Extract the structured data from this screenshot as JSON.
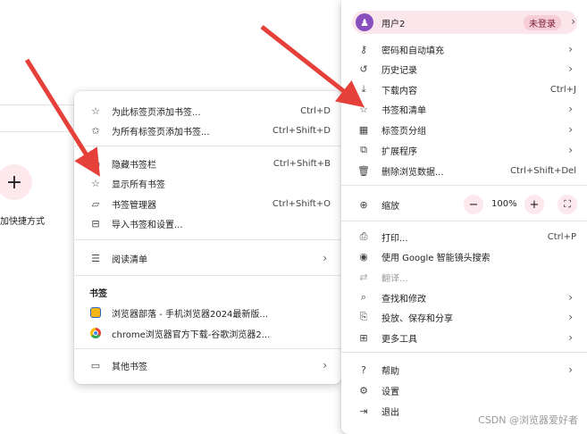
{
  "background": {
    "add_button_icon": "+",
    "add_shortcut_label": "加快捷方式"
  },
  "bookmarks_menu": {
    "items": [
      {
        "label": "为此标签页添加书签...",
        "shortcut": "Ctrl+D",
        "icon": "star-outline-icon"
      },
      {
        "label": "为所有标签页添加书签...",
        "shortcut": "Ctrl+Shift+D",
        "icon": "star-multi-icon"
      },
      {
        "label": "隐藏书签栏",
        "shortcut": "Ctrl+Shift+B",
        "icon": "bookmark-bar-icon"
      },
      {
        "label": "显示所有书签",
        "shortcut": "",
        "icon": "star-outline-icon"
      },
      {
        "label": "书签管理器",
        "shortcut": "Ctrl+Shift+O",
        "icon": "folder-star-icon"
      },
      {
        "label": "导入书签和设置...",
        "shortcut": "",
        "icon": "import-icon"
      }
    ],
    "reading_list": {
      "label": "阅读清单",
      "icon": "list-icon"
    },
    "section_title": "书签",
    "bookmarks": [
      {
        "label": "浏览器部落 - 手机浏览器2024最新版..."
      },
      {
        "label": "chrome浏览器官方下载-谷歌浏览器2..."
      }
    ],
    "other_bookmarks": {
      "label": "其他书签",
      "icon": "folder-icon"
    }
  },
  "main_menu": {
    "profile": {
      "name": "用户2",
      "status": "未登录"
    },
    "group1": [
      {
        "label": "密码和自动填充",
        "shortcut": "",
        "arrow": true,
        "icon": "key-icon"
      },
      {
        "label": "历史记录",
        "shortcut": "",
        "arrow": true,
        "icon": "history-icon"
      },
      {
        "label": "下载内容",
        "shortcut": "Ctrl+J",
        "arrow": false,
        "icon": "download-icon"
      },
      {
        "label": "书签和清单",
        "shortcut": "",
        "arrow": true,
        "icon": "star-icon"
      },
      {
        "label": "标签页分组",
        "shortcut": "",
        "arrow": true,
        "icon": "grid-icon"
      },
      {
        "label": "扩展程序",
        "shortcut": "",
        "arrow": true,
        "icon": "puzzle-icon"
      },
      {
        "label": "删除浏览数据...",
        "shortcut": "Ctrl+Shift+Del",
        "arrow": false,
        "icon": "trash-icon"
      }
    ],
    "zoom": {
      "label": "缩放",
      "minus": "−",
      "value": "100%",
      "plus": "+"
    },
    "group2": [
      {
        "label": "打印...",
        "shortcut": "Ctrl+P",
        "arrow": false,
        "icon": "print-icon"
      },
      {
        "label": "使用 Google 智能镜头搜索",
        "shortcut": "",
        "arrow": false,
        "icon": "lens-icon"
      },
      {
        "label": "翻译...",
        "shortcut": "",
        "arrow": false,
        "icon": "translate-icon"
      },
      {
        "label": "查找和修改",
        "shortcut": "",
        "arrow": true,
        "icon": "find-icon"
      },
      {
        "label": "投放、保存和分享",
        "shortcut": "",
        "arrow": true,
        "icon": "cast-icon"
      },
      {
        "label": "更多工具",
        "shortcut": "",
        "arrow": true,
        "icon": "toolbox-icon"
      }
    ],
    "group3": [
      {
        "label": "帮助",
        "shortcut": "",
        "arrow": true,
        "icon": "help-icon"
      },
      {
        "label": "设置",
        "shortcut": "",
        "arrow": false,
        "icon": "gear-icon"
      },
      {
        "label": "退出",
        "shortcut": "",
        "arrow": false,
        "icon": "exit-icon"
      }
    ]
  },
  "watermark": "CSDN @浏览器爱好者",
  "colors": {
    "accent_pink": "#fde8ee",
    "arrow_red": "#e5413a",
    "avatar_purple": "#8a4fbf"
  }
}
